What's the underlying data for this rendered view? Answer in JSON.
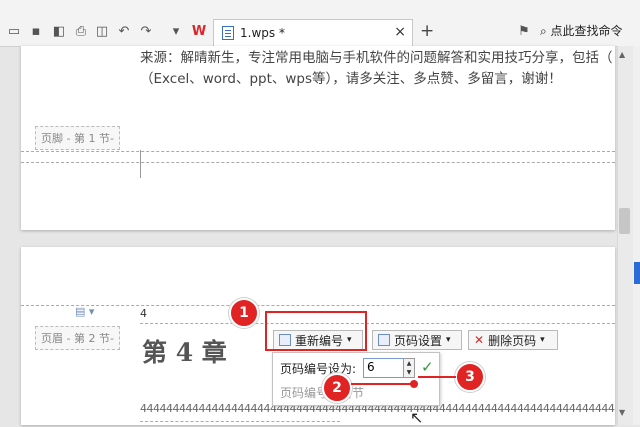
{
  "toolbar": {
    "tab_title": "1.wps *",
    "tab_close": "×",
    "new_tab": "+",
    "search_label": "点此查找命令"
  },
  "page1": {
    "line1": "来源：解晴新生，专注常用电脑与手机软件的问题解答和实用技巧分享，包括（",
    "line2": "（Excel、word、ppt、wps等），请多关注、多点赞、多留言，谢谢！",
    "footer_label": "页脚 - 第 1 节-"
  },
  "page2": {
    "header_label": "页眉 - 第 2 节-",
    "header_number": "4",
    "chapter_title": "第 4 章",
    "body_digits": "44444444444444444444444444444444444444444444444444444444444444444444444444444444"
  },
  "hf_toolbar": {
    "renumber": "重新编号",
    "page_setup": "页码设置",
    "delete_number": "删除页码",
    "dropdown_arrow": "▾"
  },
  "popup": {
    "label": "页码编号设为:",
    "value": "6",
    "sub_label": "页码编号续前节"
  },
  "annotations": {
    "step1": "1",
    "step2": "2",
    "step3": "3",
    "color": "#e02323"
  }
}
